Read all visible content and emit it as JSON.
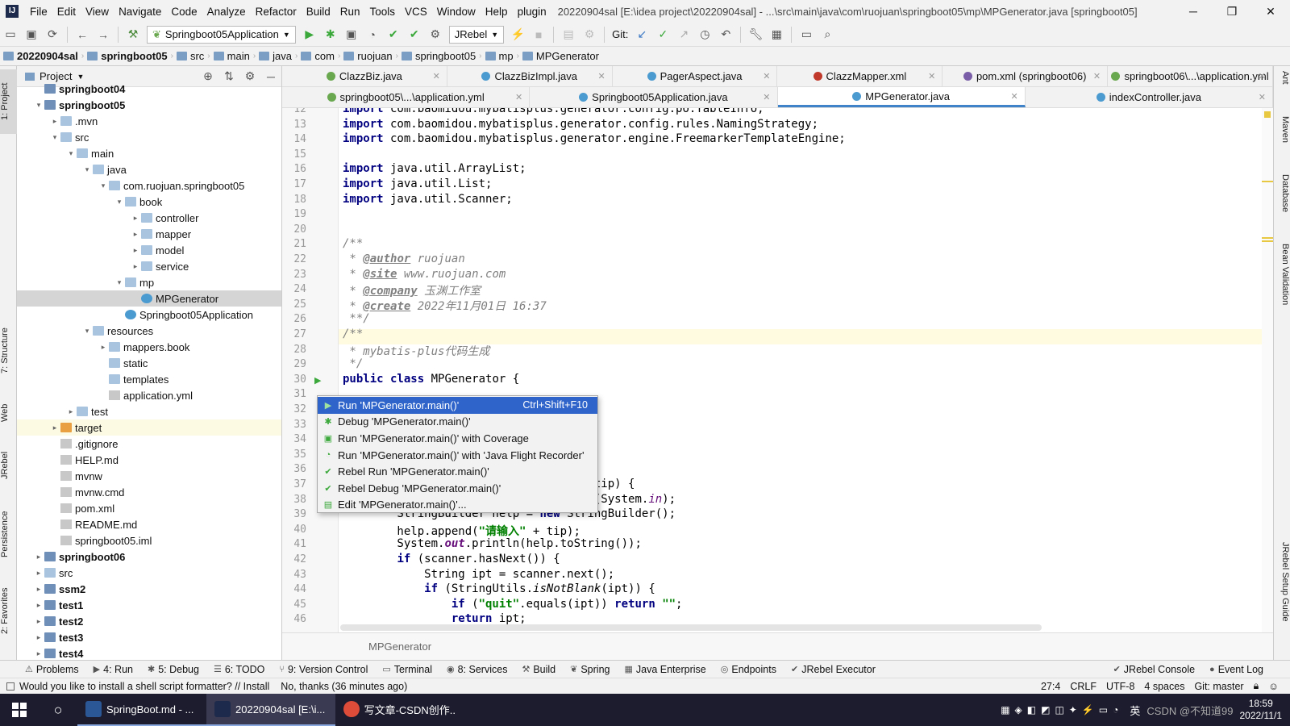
{
  "menubar": {
    "items": [
      "File",
      "Edit",
      "View",
      "Navigate",
      "Code",
      "Analyze",
      "Refactor",
      "Build",
      "Run",
      "Tools",
      "VCS",
      "Window",
      "Help",
      "plugin"
    ],
    "title": "20220904sal [E:\\idea project\\20220904sal] - ...\\src\\main\\java\\com\\ruojuan\\springboot05\\mp\\MPGenerator.java [springboot05]"
  },
  "toolbar": {
    "run_config": "Springboot05Application",
    "jrebel": "JRebel",
    "git_label": "Git:"
  },
  "breadcrumb": [
    "20220904sal",
    "springboot05",
    "src",
    "main",
    "java",
    "com",
    "ruojuan",
    "springboot05",
    "mp",
    "MPGenerator"
  ],
  "left_tool_tabs": [
    "1: Project",
    "7: Structure",
    "Web",
    "JRebel",
    "Persistence",
    "2: Favorites"
  ],
  "right_tool_tabs": [
    "Ant",
    "Maven",
    "Database",
    "Bean Validation",
    "JRebel Setup Guide"
  ],
  "project": {
    "header": "Project",
    "tree": [
      {
        "label": "springboot04",
        "depth": 0,
        "type": "mod",
        "bold": true,
        "chev": ""
      },
      {
        "label": "springboot05",
        "depth": 0,
        "type": "mod",
        "bold": true,
        "chev": "▾"
      },
      {
        "label": ".mvn",
        "depth": 1,
        "type": "fold",
        "chev": "▸"
      },
      {
        "label": "src",
        "depth": 1,
        "type": "fold",
        "chev": "▾"
      },
      {
        "label": "main",
        "depth": 2,
        "type": "fold",
        "chev": "▾"
      },
      {
        "label": "java",
        "depth": 3,
        "type": "fold",
        "chev": "▾"
      },
      {
        "label": "com.ruojuan.springboot05",
        "depth": 4,
        "type": "fold",
        "chev": "▾"
      },
      {
        "label": "book",
        "depth": 5,
        "type": "fold",
        "chev": "▾"
      },
      {
        "label": "controller",
        "depth": 6,
        "type": "fold",
        "chev": "▸"
      },
      {
        "label": "mapper",
        "depth": 6,
        "type": "fold",
        "chev": "▸"
      },
      {
        "label": "model",
        "depth": 6,
        "type": "fold",
        "chev": "▸"
      },
      {
        "label": "service",
        "depth": 6,
        "type": "fold",
        "chev": "▸"
      },
      {
        "label": "mp",
        "depth": 5,
        "type": "fold",
        "chev": "▾"
      },
      {
        "label": "MPGenerator",
        "depth": 6,
        "type": "cls",
        "chev": "",
        "selected": true
      },
      {
        "label": "Springboot05Application",
        "depth": 5,
        "type": "cls",
        "chev": ""
      },
      {
        "label": "resources",
        "depth": 3,
        "type": "fold",
        "chev": "▾"
      },
      {
        "label": "mappers.book",
        "depth": 4,
        "type": "fold",
        "chev": "▸"
      },
      {
        "label": "static",
        "depth": 4,
        "type": "fold",
        "chev": ""
      },
      {
        "label": "templates",
        "depth": 4,
        "type": "fold",
        "chev": ""
      },
      {
        "label": "application.yml",
        "depth": 4,
        "type": "file",
        "chev": ""
      },
      {
        "label": "test",
        "depth": 2,
        "type": "fold",
        "chev": "▸"
      },
      {
        "label": "target",
        "depth": 1,
        "type": "org",
        "chev": "▸",
        "highlight": true
      },
      {
        "label": ".gitignore",
        "depth": 1,
        "type": "file",
        "chev": ""
      },
      {
        "label": "HELP.md",
        "depth": 1,
        "type": "file",
        "chev": ""
      },
      {
        "label": "mvnw",
        "depth": 1,
        "type": "file",
        "chev": ""
      },
      {
        "label": "mvnw.cmd",
        "depth": 1,
        "type": "file",
        "chev": ""
      },
      {
        "label": "pom.xml",
        "depth": 1,
        "type": "file",
        "chev": ""
      },
      {
        "label": "README.md",
        "depth": 1,
        "type": "file",
        "chev": ""
      },
      {
        "label": "springboot05.iml",
        "depth": 1,
        "type": "file",
        "chev": ""
      },
      {
        "label": "springboot06",
        "depth": 0,
        "type": "mod",
        "bold": true,
        "chev": "▸"
      },
      {
        "label": "src",
        "depth": 0,
        "type": "fold",
        "chev": "▸"
      },
      {
        "label": "ssm2",
        "depth": 0,
        "type": "mod",
        "bold": true,
        "chev": "▸"
      },
      {
        "label": "test1",
        "depth": 0,
        "type": "mod",
        "bold": true,
        "chev": "▸"
      },
      {
        "label": "test2",
        "depth": 0,
        "type": "mod",
        "bold": true,
        "chev": "▸"
      },
      {
        "label": "test3",
        "depth": 0,
        "type": "mod",
        "bold": true,
        "chev": "▸"
      },
      {
        "label": "test4",
        "depth": 0,
        "type": "mod",
        "bold": true,
        "chev": "▸"
      }
    ]
  },
  "tabs_row1": [
    {
      "label": "ClazzBiz.java",
      "icon": "g"
    },
    {
      "label": "ClazzBizImpl.java",
      "icon": "b"
    },
    {
      "label": "PagerAspect.java",
      "icon": "b"
    },
    {
      "label": "ClazzMapper.xml",
      "icon": "r"
    },
    {
      "label": "pom.xml (springboot06)",
      "icon": "m"
    },
    {
      "label": "springboot06\\...\\application.yml",
      "icon": "g"
    }
  ],
  "tabs_row2": [
    {
      "label": "springboot05\\...\\application.yml",
      "icon": "g",
      "active": false
    },
    {
      "label": "Springboot05Application.java",
      "icon": "b",
      "active": false
    },
    {
      "label": "MPGenerator.java",
      "icon": "b",
      "active": true
    },
    {
      "label": "indexController.java",
      "icon": "b",
      "active": false
    }
  ],
  "code_lines": [
    {
      "n": "12",
      "html": "<span class='kw'>import</span> com.baomidou.mybatisplus.generator.config.po.TableInfo;"
    },
    {
      "n": "13",
      "html": "<span class='kw'>import</span> com.baomidou.mybatisplus.generator.config.rules.NamingStrategy;"
    },
    {
      "n": "14",
      "html": "<span class='kw'>import</span> com.baomidou.mybatisplus.generator.engine.FreemarkerTemplateEngine;"
    },
    {
      "n": "15",
      "html": ""
    },
    {
      "n": "16",
      "html": "<span class='kw'>import</span> java.util.ArrayList;"
    },
    {
      "n": "17",
      "html": "<span class='kw'>import</span> java.util.List;"
    },
    {
      "n": "18",
      "html": "<span class='kw'>import</span> java.util.Scanner;"
    },
    {
      "n": "19",
      "html": ""
    },
    {
      "n": "20",
      "html": ""
    },
    {
      "n": "21",
      "html": "<span class='cm'>/**</span>"
    },
    {
      "n": "22",
      "html": "<span class='cm'> * </span><span class='tag'>@author</span><span class='cm'> ruojuan</span>"
    },
    {
      "n": "23",
      "html": "<span class='cm'> * </span><span class='tag'>@site</span><span class='cm'> www.ruojuan.com</span>"
    },
    {
      "n": "24",
      "html": "<span class='cm'> * </span><span class='tag'>@company</span><span class='cm'> 玉渊工作室</span>"
    },
    {
      "n": "25",
      "html": "<span class='cm'> * </span><span class='tag'>@create</span><span class='cm'> 2022年11月01日 16:37</span>"
    },
    {
      "n": "26",
      "html": "<span class='cm'> **/</span>"
    },
    {
      "n": "27",
      "html": "<span class='cm'>/**</span>"
    },
    {
      "n": "28",
      "html": "<span class='cm'> * mybatis-plus代码生成</span>"
    },
    {
      "n": "29",
      "html": "<span class='cm'> */</span>"
    },
    {
      "n": "30",
      "html": "<span class='kw'>public class</span> MPGenerator {"
    },
    {
      "n": "31",
      "html": ""
    },
    {
      "n": "32",
      "html": ""
    },
    {
      "n": "33",
      "html": ""
    },
    {
      "n": "34",
      "html": ""
    },
    {
      "n": "35",
      "html": ""
    },
    {
      "n": "36",
      "html": ""
    },
    {
      "n": "37",
      "html": "                                ring tip) {"
    },
    {
      "n": "38",
      "html": "        Scanner scanner = <span class='kw'>new</span> Scanner(System.<i style='color:#660e7a'>in</i>);"
    },
    {
      "n": "39",
      "html": "        StringBuilder help = <span class='kw'>new</span> StringBuilder();"
    },
    {
      "n": "40",
      "html": "        help.append(<span class='str'>\"请输入\"</span> + tip);"
    },
    {
      "n": "41",
      "html": "        System.<i style='color:#660e7a;font-weight:bold'>out</i>.println(help.toString());"
    },
    {
      "n": "42",
      "html": "        <span class='kw'>if</span> (scanner.hasNext()) {"
    },
    {
      "n": "43",
      "html": "            String ipt = scanner.next();"
    },
    {
      "n": "44",
      "html": "            <span class='kw'>if</span> (StringUtils.<i>isNotBlank</i>(ipt)) {"
    },
    {
      "n": "45",
      "html": "                <span class='kw'>if</span> (<span class='str'>\"quit\"</span>.equals(ipt)) <span class='kw'>return</span> <span class='str'>\"\"</span>;"
    },
    {
      "n": "46",
      "html": "                <span class='kw'>return</span> ipt;"
    }
  ],
  "popup": {
    "items": [
      {
        "label": "Run 'MPGenerator.main()'",
        "shortcut": "Ctrl+Shift+F10",
        "icon": "▶",
        "selected": true
      },
      {
        "label": "Debug 'MPGenerator.main()'",
        "shortcut": "",
        "icon": "✱",
        "selected": false
      },
      {
        "label": "Run 'MPGenerator.main()' with Coverage",
        "shortcut": "",
        "icon": "▣",
        "selected": false
      },
      {
        "label": "Run 'MPGenerator.main()' with 'Java Flight Recorder'",
        "shortcut": "",
        "icon": "◔",
        "selected": false
      },
      {
        "label": "Rebel Run 'MPGenerator.main()'",
        "shortcut": "",
        "icon": "✔",
        "selected": false
      },
      {
        "label": "Rebel Debug 'MPGenerator.main()'",
        "shortcut": "",
        "icon": "✔",
        "selected": false
      },
      {
        "label": "Edit 'MPGenerator.main()'...",
        "shortcut": "",
        "icon": "▤",
        "selected": false
      }
    ]
  },
  "editor_footer": "MPGenerator",
  "bottom_tools": [
    {
      "label": "Problems",
      "icon": "⚠"
    },
    {
      "label": "4: Run",
      "icon": "▶"
    },
    {
      "label": "5: Debug",
      "icon": "✱"
    },
    {
      "label": "6: TODO",
      "icon": "☰"
    },
    {
      "label": "9: Version Control",
      "icon": "⑂"
    },
    {
      "label": "Terminal",
      "icon": "▭"
    },
    {
      "label": "8: Services",
      "icon": "◉"
    },
    {
      "label": "Build",
      "icon": "⚒"
    },
    {
      "label": "Spring",
      "icon": "❦"
    },
    {
      "label": "Java Enterprise",
      "icon": "▦"
    },
    {
      "label": "Endpoints",
      "icon": "◎"
    },
    {
      "label": "JRebel Executor",
      "icon": "✔"
    }
  ],
  "bottom_right_tools": [
    {
      "label": "JRebel Console",
      "icon": "✔"
    },
    {
      "label": "Event Log",
      "icon": "●"
    }
  ],
  "statusbar": {
    "message": "Would you like to install a shell script formatter? // Install    No, thanks (36 minutes ago)",
    "position": "27:4",
    "line_sep": "CRLF",
    "encoding": "UTF-8",
    "indent": "4 spaces",
    "git": "Git: master"
  },
  "taskbar": {
    "items": [
      {
        "label": "SpringBoot.md - ...",
        "active": false
      },
      {
        "label": "20220904sal [E:\\i...",
        "active": true
      },
      {
        "label": "写文章-CSDN创作...",
        "active": false
      }
    ],
    "time": "18:59",
    "date": "2022/11/1",
    "ime": "英",
    "watermark": "CSDN @不知道99"
  },
  "colors": {
    "accent": "#2f65ca",
    "caret_line": "#fffbe0",
    "selection": "#d5d5d5"
  }
}
